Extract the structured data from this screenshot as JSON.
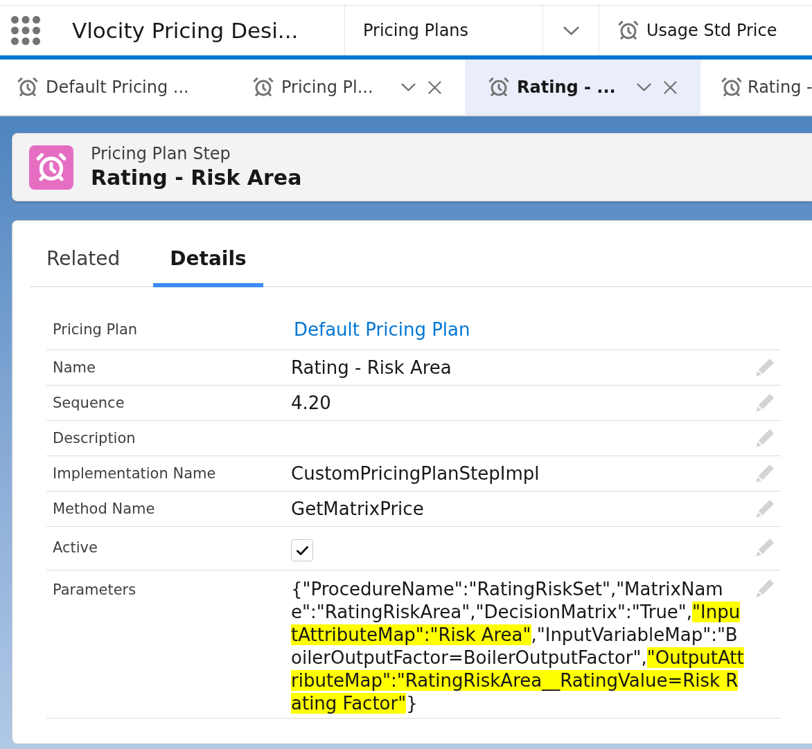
{
  "app_bar": {
    "title": "Vlocity Pricing Desi...",
    "nav_item": {
      "label": "Pricing Plans"
    },
    "pinned_tab": {
      "label": "Usage Std Price"
    }
  },
  "workspace_tabs": [
    {
      "label": "Default Pricing ...",
      "selected": false,
      "actions": false
    },
    {
      "label": "Pricing Pl...",
      "selected": false,
      "actions": true
    },
    {
      "label": "Rating - ...",
      "selected": true,
      "actions": true
    },
    {
      "label": "Rating -",
      "selected": false,
      "actions": false
    }
  ],
  "record_header": {
    "object_type": "Pricing Plan Step",
    "title": "Rating - Risk Area"
  },
  "record_tabs": [
    {
      "label": "Related",
      "selected": false
    },
    {
      "label": "Details",
      "selected": true
    }
  ],
  "fields": [
    {
      "kind": "link",
      "label": "Pricing Plan",
      "value": "Default Pricing Plan",
      "editable": false
    },
    {
      "kind": "text",
      "label": "Name",
      "value": "Rating - Risk Area",
      "editable": true
    },
    {
      "kind": "text",
      "label": "Sequence",
      "value": "4.20",
      "editable": true
    },
    {
      "kind": "text",
      "label": "Description",
      "editable": true
    },
    {
      "kind": "text",
      "label": "Implementation Name",
      "value": "CustomPricingPlanStepImpl",
      "editable": true
    },
    {
      "kind": "text",
      "label": "Method Name",
      "value": "GetMatrixPrice",
      "editable": true
    },
    {
      "kind": "checkbox",
      "label": "Active",
      "checked": true,
      "editable": true
    },
    {
      "kind": "json",
      "label": "Parameters",
      "editable": true,
      "segments": [
        {
          "text": "{\"ProcedureName\":\"RatingRiskSet\",\"MatrixName\":\"RatingRiskArea\",\"DecisionMatrix\":\"True\",",
          "highlighted": false
        },
        {
          "text": "\"InputAttributeMap\":\"Risk Area\"",
          "highlighted": true
        },
        {
          "text": ",\"InputVariableMap\":\"BoilerOutputFactor=BoilerOutputFactor\",",
          "highlighted": false
        },
        {
          "text": "\"OutputAttributeMap\":\"RatingRiskArea__RatingValue=Risk Rating Factor\"",
          "highlighted": true
        },
        {
          "text": "}",
          "highlighted": false
        }
      ]
    }
  ]
}
